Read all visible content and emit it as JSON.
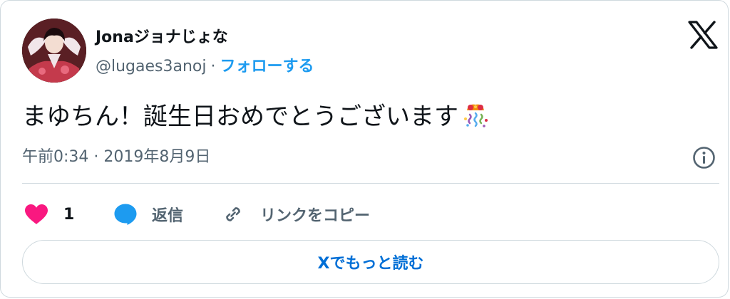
{
  "author": {
    "name": "Jonaジョナじょな",
    "handle": "@lugaes3anoj",
    "separator": "·",
    "follow_label": "フォローする"
  },
  "tweet": {
    "text": "まゆちん！誕生日おめでとうございます",
    "emoji": "party-popper",
    "timestamp": "午前0:34 · 2019年8月9日"
  },
  "actions": {
    "like_count": "1",
    "reply_label": "返信",
    "copy_link_label": "リンクをコピー"
  },
  "read_more_label": "Xでもっと読む",
  "colors": {
    "accent": "#1d9bf0",
    "link": "#006fd6",
    "like": "#f91880",
    "secondary_text": "#536471",
    "border": "#cfd9de"
  },
  "icons": {
    "brand": "x-logo-icon",
    "info": "info-icon",
    "like": "heart-icon",
    "reply": "speech-bubble-icon",
    "copy": "link-icon"
  }
}
